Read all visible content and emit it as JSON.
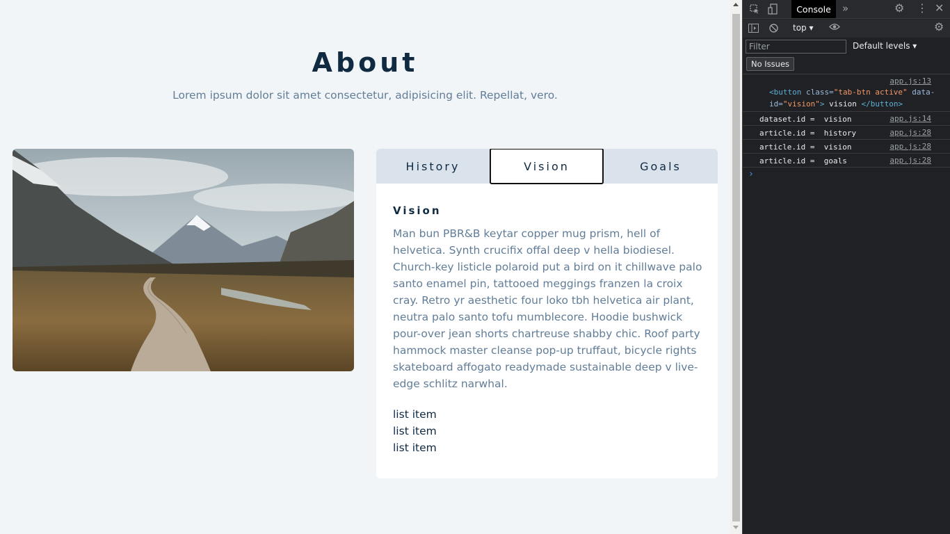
{
  "page": {
    "title": "About",
    "subtitle": "Lorem ipsum dolor sit amet consectetur, adipisicing elit. Repellat, vero.",
    "tabs": [
      {
        "label": "History",
        "active": false
      },
      {
        "label": "Vision",
        "active": true
      },
      {
        "label": "Goals",
        "active": false
      }
    ],
    "article": {
      "heading": "Vision",
      "body": "Man bun PBR&B keytar copper mug prism, hell of helvetica. Synth crucifix offal deep v hella biodiesel. Church-key listicle polaroid put a bird on it chillwave palo santo enamel pin, tattooed meggings franzen la croix cray. Retro yr aesthetic four loko tbh helvetica air plant, neutra palo santo tofu mumblecore. Hoodie bushwick pour-over jean shorts chartreuse shabby chic. Roof party hammock master cleanse pop-up truffaut, bicycle rights skateboard affogato readymade sustainable deep v live-edge schlitz narwhal.",
      "list": [
        "list item",
        "list item",
        "list item"
      ]
    },
    "colors": {
      "primary_text": "#102a42",
      "muted_text": "#617d98",
      "background": "#f1f5f8",
      "tab_bg": "#dae2ec"
    }
  },
  "devtools": {
    "tab": "Console",
    "context": "top",
    "filter_placeholder": "Filter",
    "levels": "Default levels",
    "issues": "No Issues",
    "logs": [
      {
        "source": "app.js:13",
        "html_tag_open": "<button",
        "html_attr_class": " class=",
        "html_val_class": "\"tab-btn active\"",
        "html_attr_data": " data-",
        "html_attr_data2": "id=",
        "html_val_data": "\"vision\"",
        "html_close": ">",
        "html_text": " vision ",
        "html_tag_close": "</button>"
      },
      {
        "message": "dataset.id =  vision",
        "source": "app.js:14"
      },
      {
        "message": "article.id =  history",
        "source": "app.js:28"
      },
      {
        "message": "article.id =  vision",
        "source": "app.js:28"
      },
      {
        "message": "article.id =  goals",
        "source": "app.js:28"
      }
    ],
    "prompt": "›"
  }
}
